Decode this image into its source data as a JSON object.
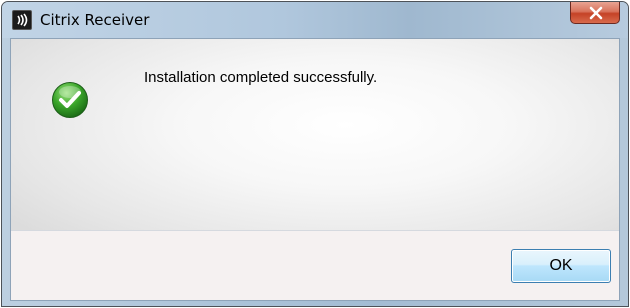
{
  "window": {
    "title": "Citrix Receiver",
    "app_icon": "citrix-receiver-icon",
    "close_icon": "close-icon"
  },
  "dialog": {
    "status_icon": "success-check-icon",
    "message": "Installation completed successfully."
  },
  "buttons": {
    "ok_label": "OK"
  },
  "colors": {
    "close_button": "#c54226",
    "success_green": "#3aa52a",
    "ok_button_border": "#3c7fb1"
  }
}
